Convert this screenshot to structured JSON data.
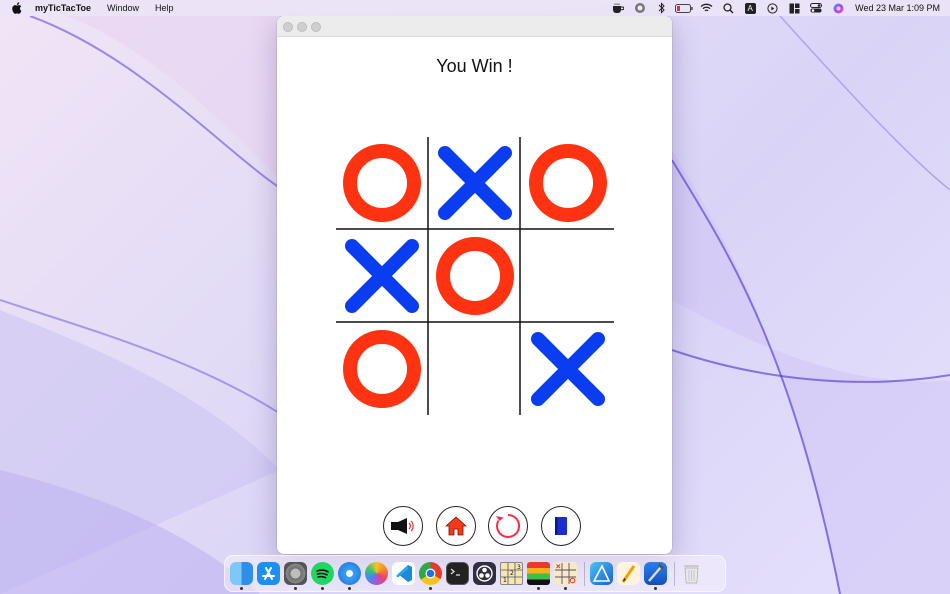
{
  "menubar": {
    "app_name": "myTicTacToe",
    "menus": [
      "Window",
      "Help"
    ],
    "status_icons": [
      "coffee-icon",
      "focus-icon",
      "bluetooth-icon",
      "battery-icon",
      "wifi-icon",
      "search-icon",
      "input-source-icon",
      "play-icon",
      "layout-icon",
      "control-center-icon",
      "siri-icon"
    ],
    "input_source_letter": "A",
    "datetime": "Wed 23 Mar  1:09 PM"
  },
  "game": {
    "status": "You Win !",
    "board": [
      "O",
      "X",
      "O",
      "X",
      "O",
      "",
      "O",
      "",
      "X"
    ],
    "o_color": "#ff3311",
    "x_color": "#0a3cf0"
  },
  "controls": [
    {
      "name": "sound-button",
      "icon": "speaker-icon"
    },
    {
      "name": "home-button",
      "icon": "home-icon"
    },
    {
      "name": "restart-button",
      "icon": "restart-icon"
    },
    {
      "name": "book-button",
      "icon": "book-icon"
    }
  ],
  "dock": {
    "apps": [
      "Finder",
      "App Store",
      "System Preferences",
      "Spotify",
      "Safari",
      "Photos",
      "Visual Studio Code",
      "Chrome",
      "Terminal",
      "OBS",
      "Sudoku",
      "Game",
      "myTicTacToe",
      "Affinity Designer",
      "Pixelmator",
      "Xcode",
      "Trash"
    ]
  }
}
